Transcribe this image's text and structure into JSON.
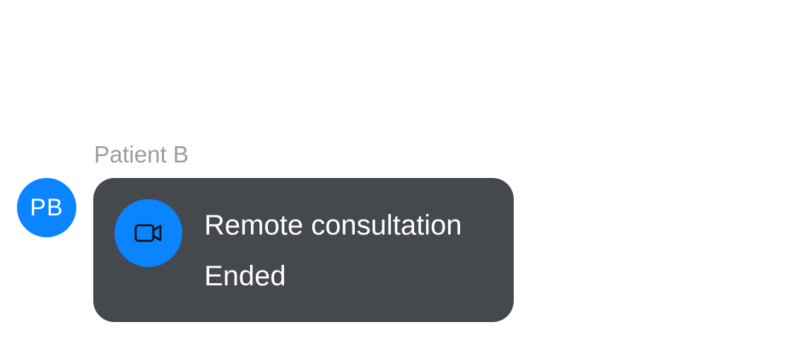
{
  "message": {
    "sender_name": "Patient B",
    "avatar_initials": "PB",
    "avatar_color": "#0a84ff",
    "bubble_color": "#45494e",
    "call": {
      "icon": "video-camera-icon",
      "title": "Remote consultation",
      "status": "Ended"
    }
  }
}
